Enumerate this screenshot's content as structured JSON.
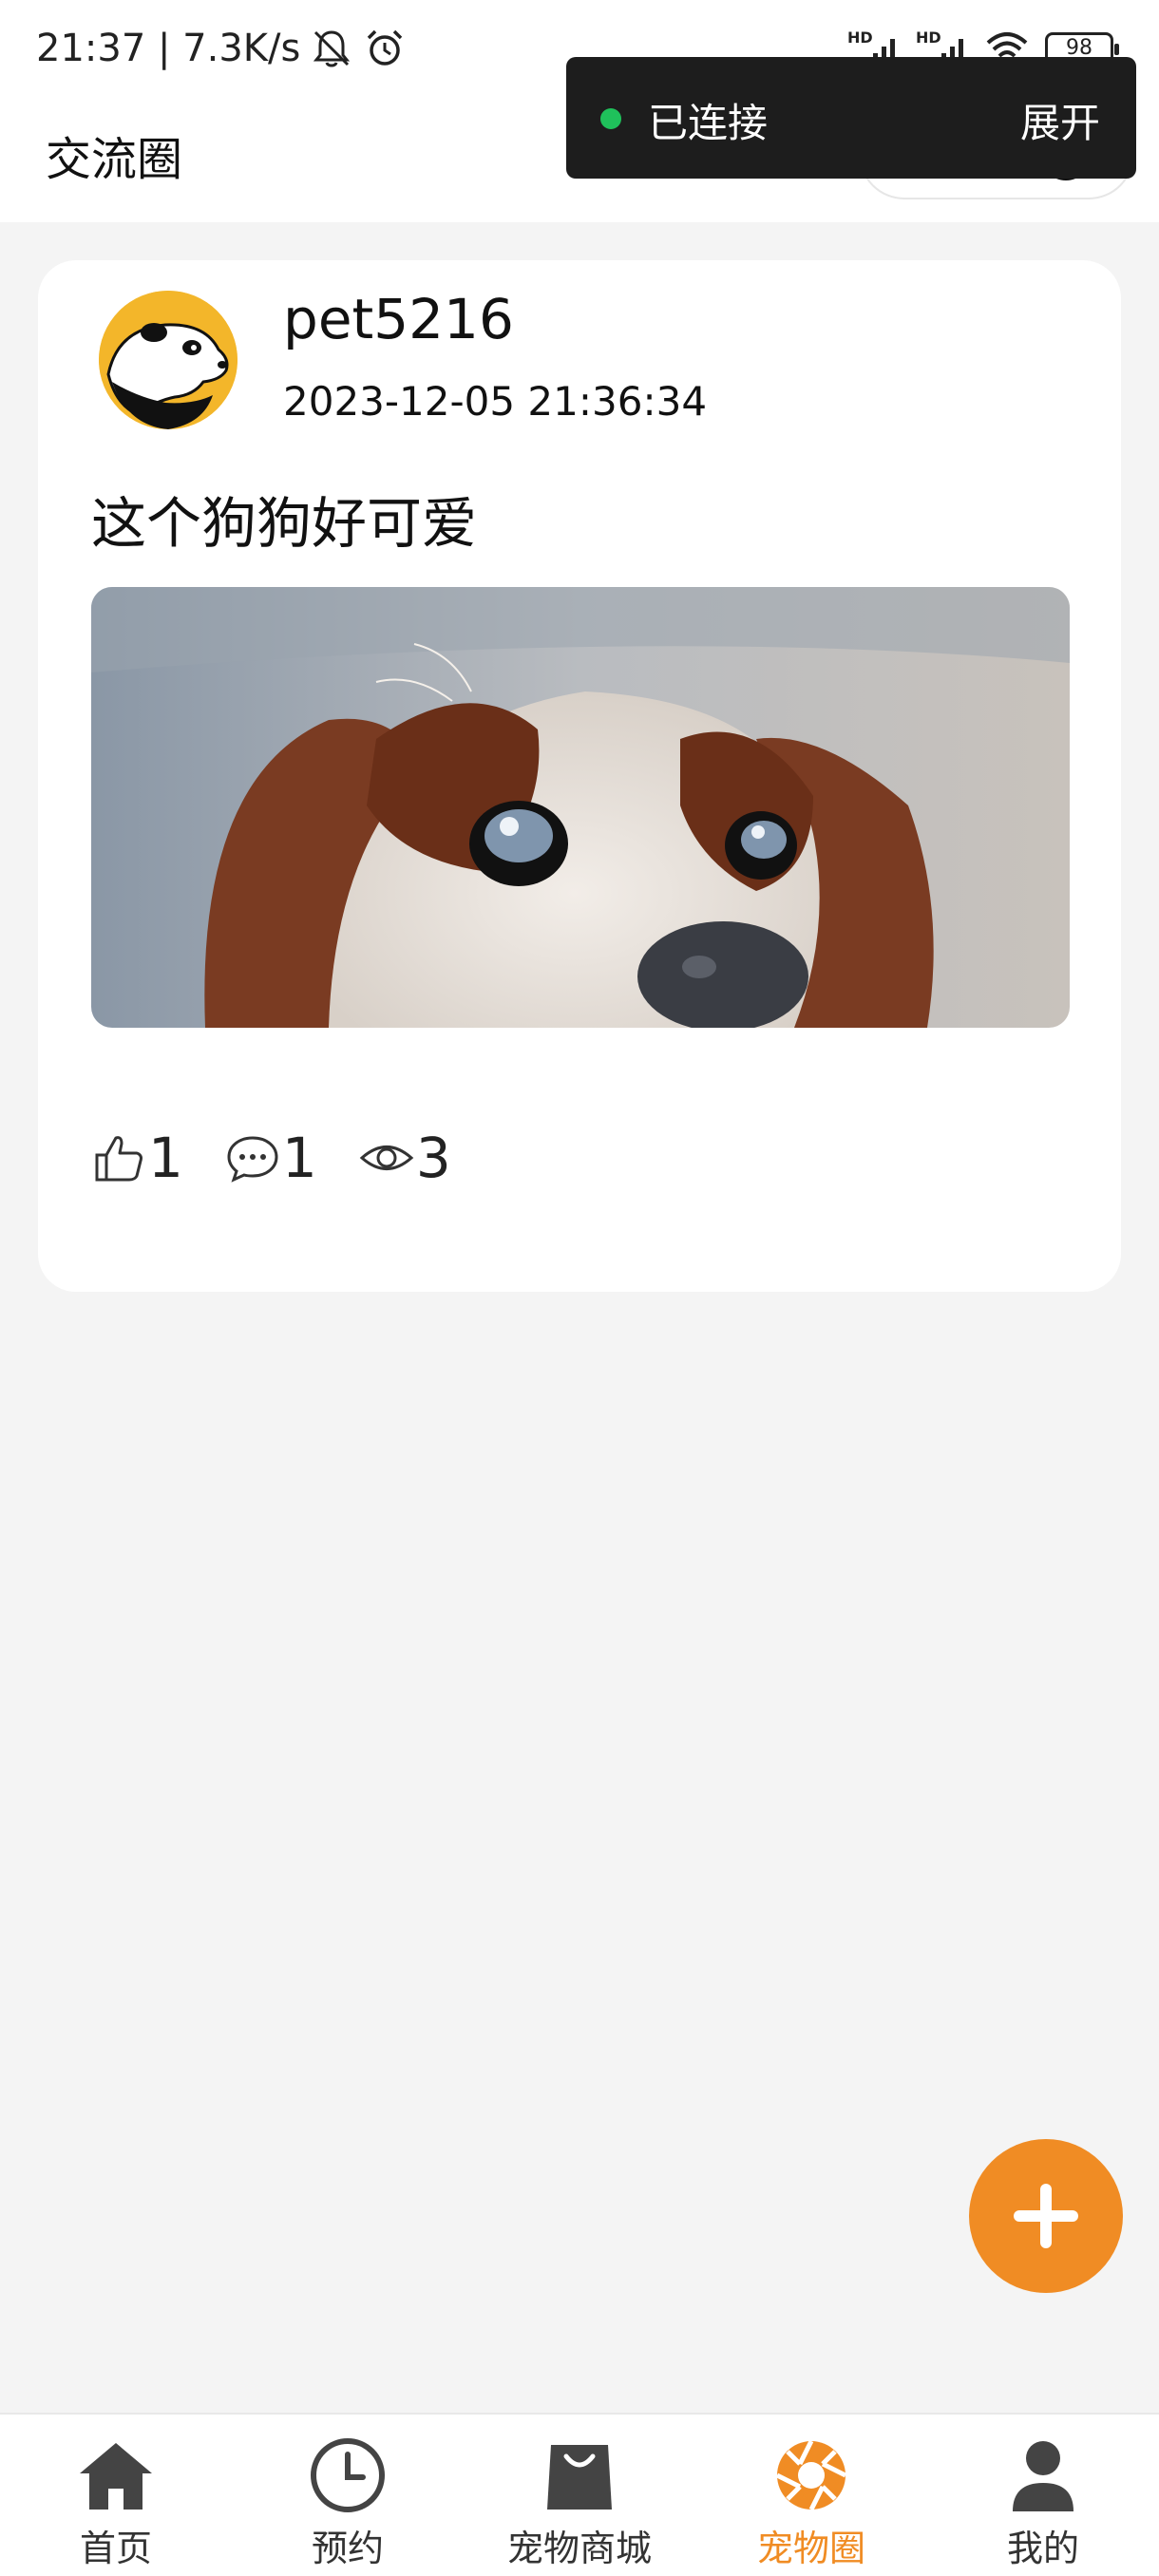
{
  "status_bar": {
    "time_speed": "21:37 | 7.3K/s",
    "hd_label_1": "HD",
    "hd_label_2": "HD",
    "battery": "98"
  },
  "header": {
    "title": "交流圈"
  },
  "toast": {
    "status": "已连接",
    "expand_label": "展开",
    "dot_color": "#1fc15b"
  },
  "post": {
    "username": "pet5216",
    "time": "2023-12-05 21:36:34",
    "content": "这个狗狗好可爱",
    "likes": "1",
    "comments": "1",
    "views": "3"
  },
  "tabbar": {
    "items": [
      {
        "label": "首页",
        "icon": "home-icon"
      },
      {
        "label": "预约",
        "icon": "clock-icon"
      },
      {
        "label": "宠物商城",
        "icon": "shopping-bag-icon"
      },
      {
        "label": "宠物圈",
        "icon": "aperture-icon",
        "active": true
      },
      {
        "label": "我的",
        "icon": "person-icon"
      }
    ],
    "active_color": "#f08c24"
  },
  "fab": {
    "icon": "plus-icon",
    "color": "#f08c24"
  }
}
